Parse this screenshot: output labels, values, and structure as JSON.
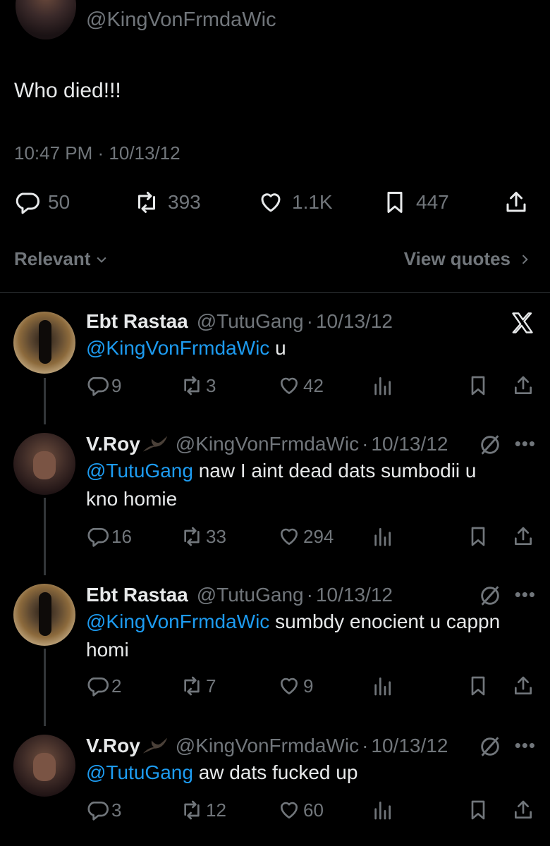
{
  "tweet": {
    "handle": "@KingVonFrmdaWic",
    "text": "Who died!!!",
    "timestamp": "10:47 PM · 10/13/12",
    "stats": {
      "replies": "50",
      "retweets": "393",
      "likes": "1.1K",
      "bookmarks": "447"
    }
  },
  "controls": {
    "sort_label": "Relevant",
    "view_quotes": "View quotes"
  },
  "replies": [
    {
      "name": "Ebt Rastaa",
      "handle": "@TutuGang",
      "date": "10/13/12",
      "mention": "@KingVonFrmdaWic",
      "text": " u",
      "replies": "9",
      "retweets": "3",
      "likes": "42",
      "corner_icon": "x-logo-icon"
    },
    {
      "name": "V.Roy",
      "handle": "@KingVonFrmdaWic",
      "date": "10/13/12",
      "mention": "@TutuGang",
      "text": " naw I aint dead dats sumbodii u kno homie",
      "replies": "16",
      "retweets": "33",
      "likes": "294",
      "corner_icon": "grok-icon"
    },
    {
      "name": "Ebt Rastaa",
      "handle": "@TutuGang",
      "date": "10/13/12",
      "mention": "@KingVonFrmdaWic",
      "text": " sumbdy enocient u cappn homi",
      "replies": "2",
      "retweets": "7",
      "likes": "9",
      "corner_icon": "grok-icon"
    },
    {
      "name": "V.Roy",
      "handle": "@KingVonFrmdaWic",
      "date": "10/13/12",
      "mention": "@TutuGang",
      "text": " aw dats fucked up",
      "replies": "3",
      "retweets": "12",
      "likes": "60",
      "corner_icon": "grok-icon"
    }
  ],
  "colors": {
    "background": "#000000",
    "text": "#e7e9ea",
    "muted": "#71767b",
    "link": "#1d9bf0"
  }
}
